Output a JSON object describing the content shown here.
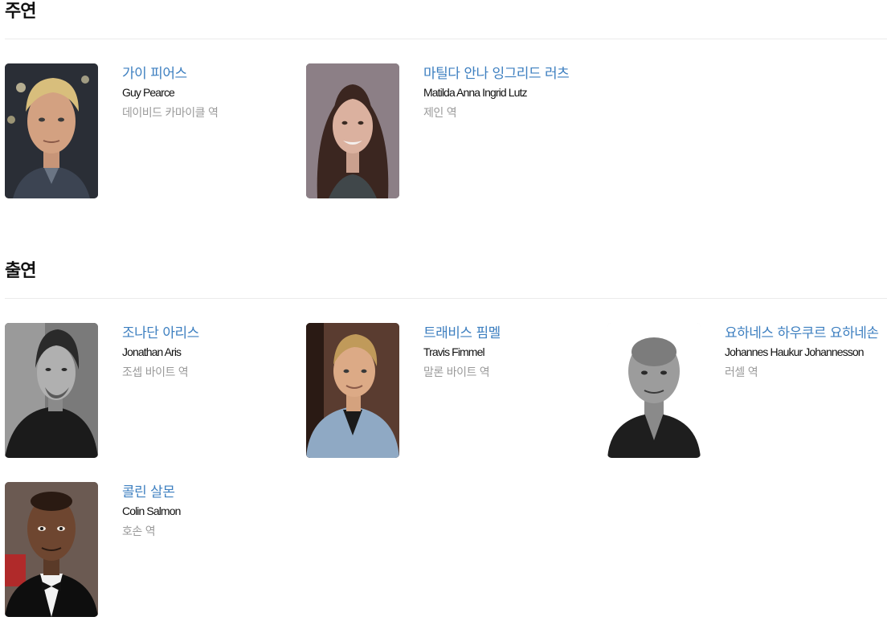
{
  "sections": [
    {
      "title": "주연",
      "cast": [
        {
          "name_ko": "가이 피어스",
          "name_en": "Guy Pearce",
          "role": "데이비드 카마이클 역",
          "photo_alt": "Guy Pearce"
        },
        {
          "name_ko": "마틸다 안나 잉그리드 러츠",
          "name_en": "Matilda Anna Ingrid Lutz",
          "role": "제인 역",
          "photo_alt": "Matilda Anna Ingrid Lutz"
        }
      ]
    },
    {
      "title": "출연",
      "cast": [
        {
          "name_ko": "조나단 아리스",
          "name_en": "Jonathan Aris",
          "role": "조셉 바이트 역",
          "photo_alt": "Jonathan Aris"
        },
        {
          "name_ko": "트래비스 핌멜",
          "name_en": "Travis Fimmel",
          "role": "말론 바이트 역",
          "photo_alt": "Travis Fimmel"
        },
        {
          "name_ko": "요하네스 하우쿠르 요하네손",
          "name_en": "Johannes Haukur Johannesson",
          "role": "러셀 역",
          "photo_alt": "Johannes Haukur Johannesson"
        },
        {
          "name_ko": "콜린 살몬",
          "name_en": "Colin Salmon",
          "role": "호손 역",
          "photo_alt": "Colin Salmon"
        }
      ]
    }
  ]
}
